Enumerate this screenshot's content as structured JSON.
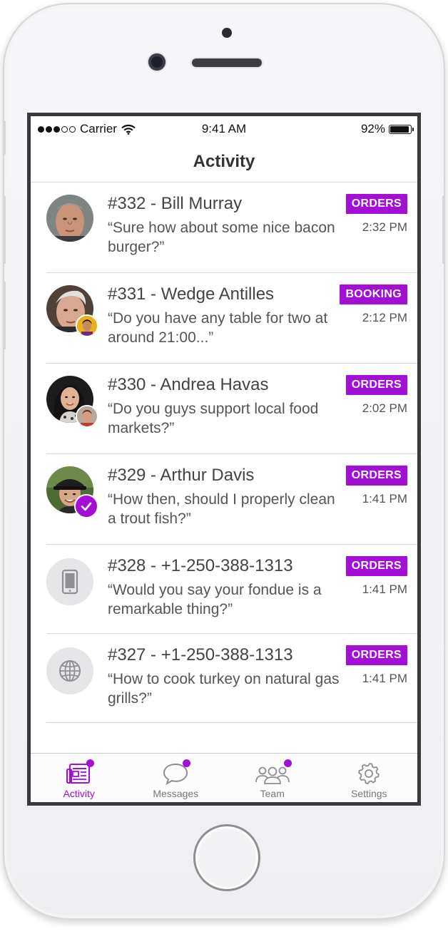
{
  "status_bar": {
    "carrier": "Carrier",
    "time": "9:41 AM",
    "battery_percent": "92%",
    "battery_level": 0.92,
    "signal_bars_filled": 3,
    "signal_bars_total": 5
  },
  "nav": {
    "title": "Activity"
  },
  "colors": {
    "accent": "#a40fd6"
  },
  "conversations": [
    {
      "title": "#332 - Bill Murray",
      "preview": "“Sure how about some nice bacon burger?”",
      "tag": "ORDERS",
      "time": "2:32 PM",
      "avatar": "photo-bill-murray"
    },
    {
      "title": "#331 - Wedge Antilles",
      "preview": "“Do you have any table for two at around 21:00...”",
      "tag": "BOOKING",
      "time": "2:12 PM",
      "avatar": "photo-wedge-antilles"
    },
    {
      "title": "#330 - Andrea Havas",
      "preview": "“Do you guys support local food markets?”",
      "tag": "ORDERS",
      "time": "2:02 PM",
      "avatar": "photo-andrea-havas"
    },
    {
      "title": "#329 - Arthur Davis",
      "preview": "“How then, should I properly clean a trout fish?”",
      "tag": "ORDERS",
      "time": "1:41 PM",
      "avatar": "photo-arthur-davis"
    },
    {
      "title": "#328 - +1-250-388-1313",
      "preview": "“Would you say your fondue is a remarkable thing?”",
      "tag": "ORDERS",
      "time": "1:41 PM",
      "avatar": "phone-icon"
    },
    {
      "title": "#327 - +1-250-388-1313",
      "preview": "“How to cook turkey on natural gas grills?”",
      "tag": "ORDERS",
      "time": "1:41 PM",
      "avatar": "globe-icon"
    }
  ],
  "tabs": [
    {
      "label": "Activity",
      "icon": "activity-icon",
      "active": true,
      "has_dot": true
    },
    {
      "label": "Messages",
      "icon": "messages-icon",
      "active": false,
      "has_dot": true
    },
    {
      "label": "Team",
      "icon": "team-icon",
      "active": false,
      "has_dot": true
    },
    {
      "label": "Settings",
      "icon": "settings-icon",
      "active": false,
      "has_dot": false
    }
  ]
}
